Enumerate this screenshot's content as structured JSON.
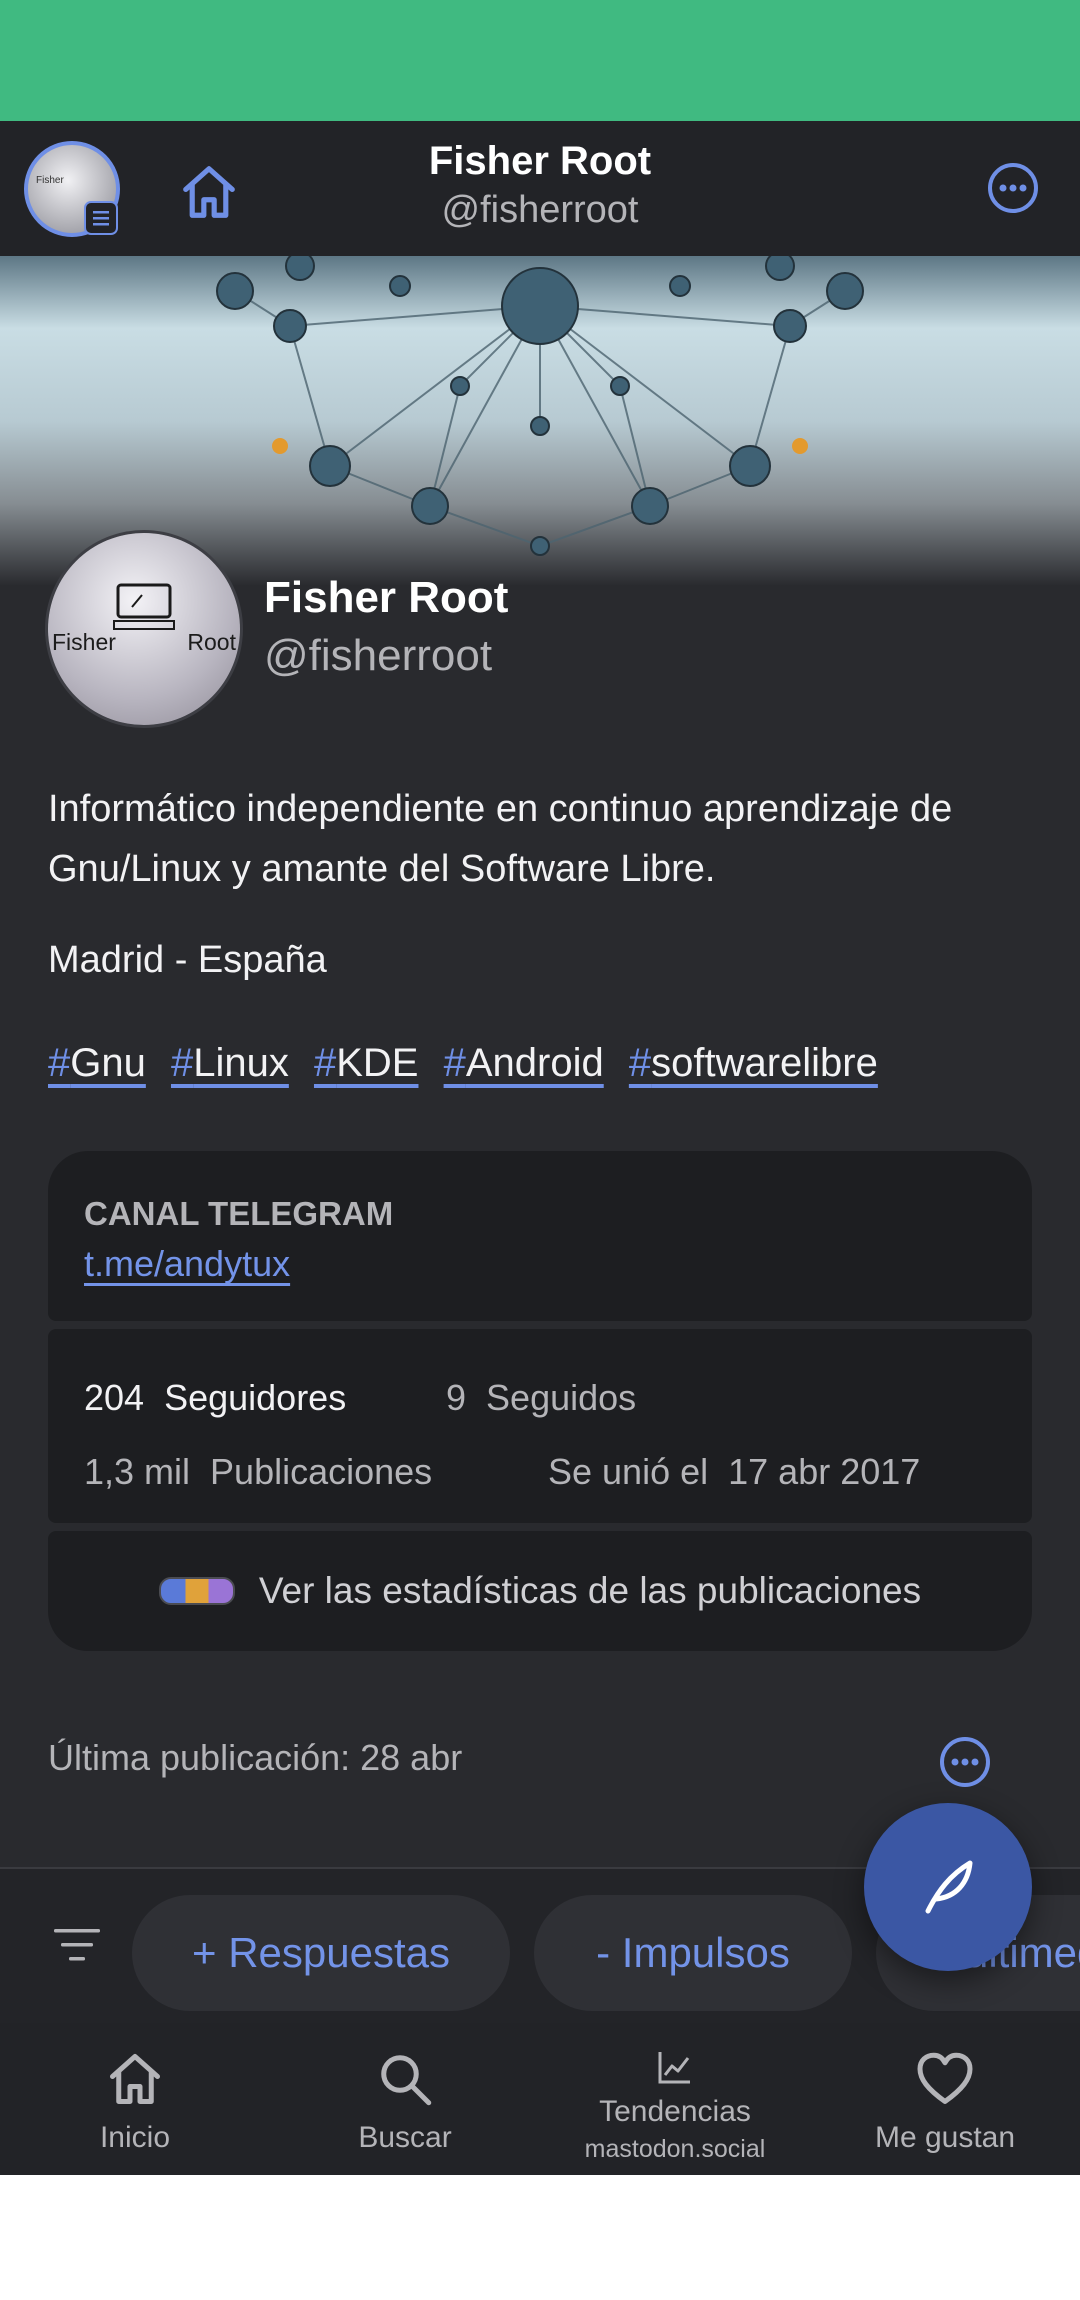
{
  "header": {
    "name": "Fisher Root",
    "handle": "@fisherroot"
  },
  "profile": {
    "name": "Fisher Root",
    "handle": "@fisherroot",
    "avatar_text_left": "Fisher",
    "avatar_text_right": "Root",
    "bio": "Informático independiente en continuo aprendizaje de Gnu/Linux y amante del Software Libre.",
    "location": "Madrid - España",
    "hashtags": [
      {
        "hash": "#",
        "tag": "Gnu"
      },
      {
        "hash": "#",
        "tag": "Linux"
      },
      {
        "hash": "#",
        "tag": "KDE"
      },
      {
        "hash": "#",
        "tag": "Android"
      },
      {
        "hash": "#",
        "tag": "softwarelibre"
      }
    ]
  },
  "field": {
    "label": "CANAL TELEGRAM",
    "value": "t.me/andytux"
  },
  "stats": {
    "followers_count": "204",
    "followers_label": "Seguidores",
    "following_count": "9",
    "following_label": "Seguidos",
    "posts_count": "1,3 mil",
    "posts_label": "Publicaciones",
    "joined_label": "Se unió el",
    "joined_date": "17 abr 2017"
  },
  "action": {
    "stats_link": "Ver las estadísticas de las publicaciones"
  },
  "last_post": "Última publicación: 28 abr",
  "filters": {
    "chips": [
      "+ Respuestas",
      "- Impulsos",
      "Multimedia"
    ]
  },
  "nav": {
    "home": "Inicio",
    "search": "Buscar",
    "trends": "Tendencias",
    "trends_sub": "mastodon.social",
    "likes": "Me gustan"
  },
  "colors": {
    "status_bar": "#40ba81",
    "accent": "#7393e8",
    "background": "#292a2e",
    "fab": "#3b57a4"
  }
}
